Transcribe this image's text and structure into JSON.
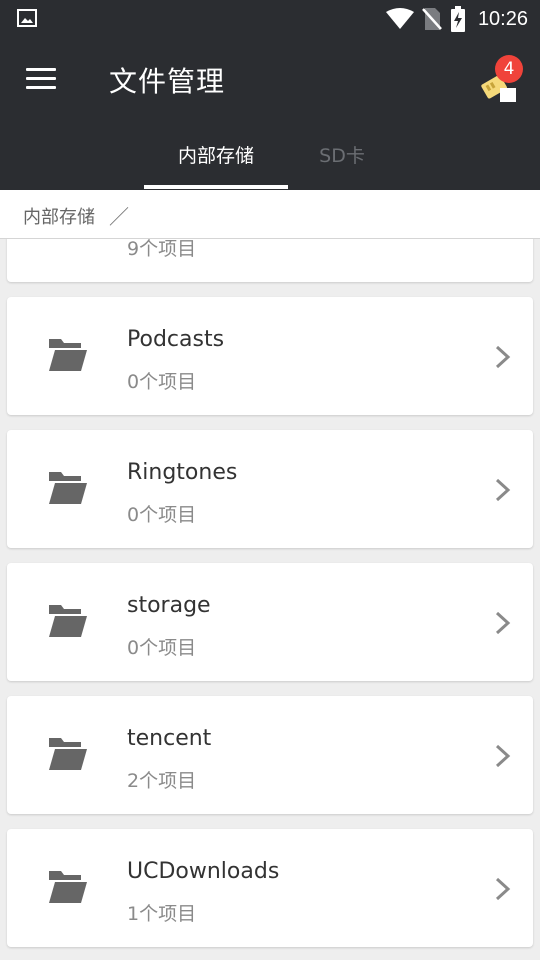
{
  "status_bar": {
    "time": "10:26",
    "icons": [
      "image-icon",
      "wifi-icon",
      "no-sim-icon",
      "battery-charging-icon"
    ]
  },
  "app_bar": {
    "title": "文件管理",
    "notification_badge": "4",
    "icons": [
      "menu-icon",
      "sd-card-icon"
    ]
  },
  "tabs": [
    {
      "label": "内部存储",
      "active": true
    },
    {
      "label": "SD卡",
      "active": false
    }
  ],
  "breadcrumb": {
    "path": "内部存储",
    "separator": "／"
  },
  "list": {
    "items": [
      {
        "name": "",
        "count": "9个项目",
        "icon": "folder-icon"
      },
      {
        "name": "Podcasts",
        "count": "0个项目",
        "icon": "folder-icon"
      },
      {
        "name": "Ringtones",
        "count": "0个项目",
        "icon": "folder-icon"
      },
      {
        "name": "storage",
        "count": "0个项目",
        "icon": "folder-icon"
      },
      {
        "name": "tencent",
        "count": "2个项目",
        "icon": "folder-icon"
      },
      {
        "name": "UCDownloads",
        "count": "1个项目",
        "icon": "folder-icon"
      }
    ]
  },
  "colors": {
    "app_bar": "#2b2d31",
    "background": "#eeeeee",
    "badge": "#f0433a",
    "folder": "#666666"
  }
}
